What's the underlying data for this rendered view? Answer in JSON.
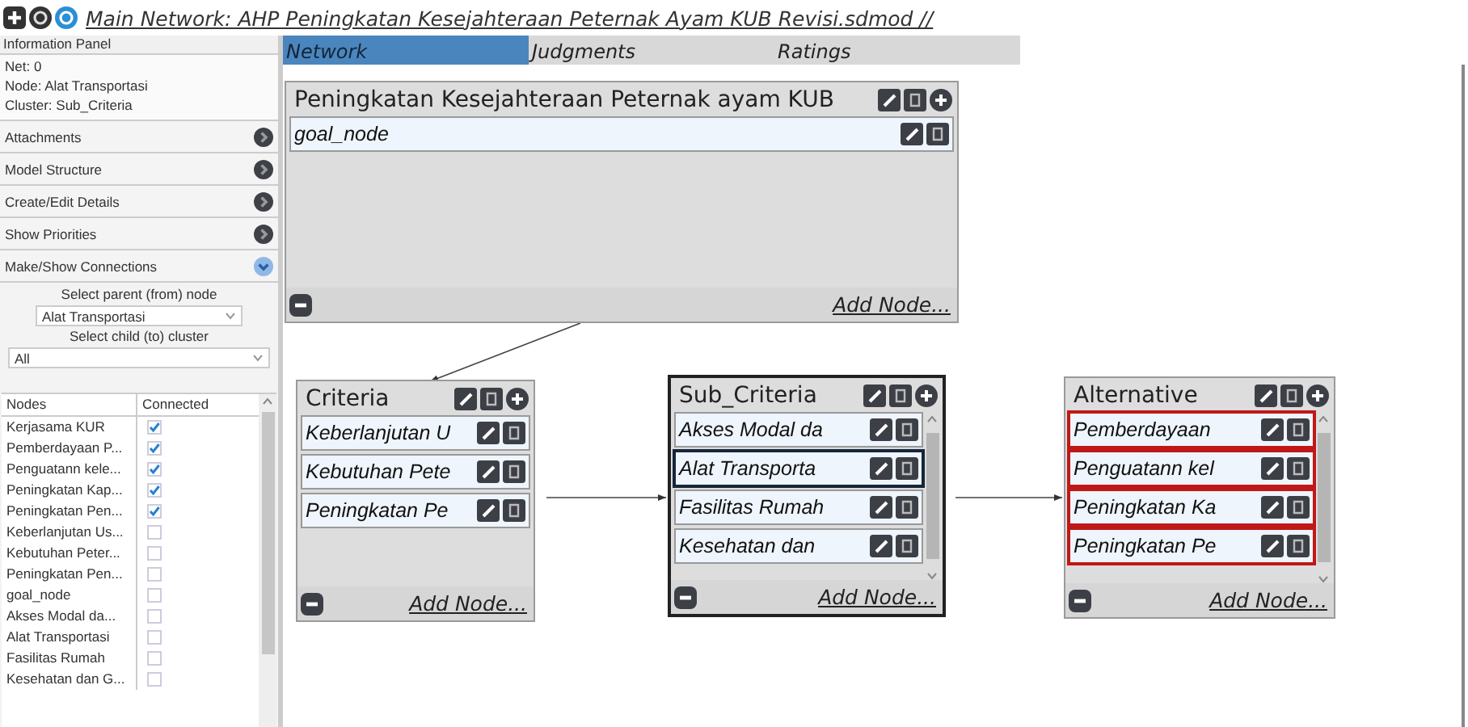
{
  "window": {
    "title": "Main Network: AHP Peningkatan Kesejahteraan Peternak Ayam KUB Revisi.sdmod //"
  },
  "info_panel": {
    "header": "Information Panel",
    "lines": [
      "Net: 0",
      "Node: Alat Transportasi",
      "Cluster: Sub_Criteria"
    ],
    "sections": [
      {
        "label": "Attachments",
        "expanded": false
      },
      {
        "label": "Model Structure",
        "expanded": false
      },
      {
        "label": "Create/Edit Details",
        "expanded": false
      },
      {
        "label": "Show Priorities",
        "expanded": false
      },
      {
        "label": "Make/Show Connections",
        "expanded": true
      }
    ],
    "parent_label": "Select parent (from) node",
    "parent_value": "Alat Transportasi",
    "child_label": "Select child (to) cluster",
    "child_value": "All",
    "table": {
      "columns": [
        "Nodes",
        "Connected"
      ],
      "rows": [
        {
          "node": "Kerjasama KUR",
          "connected": true
        },
        {
          "node": "Pemberdayaan P...",
          "connected": true
        },
        {
          "node": "Penguatann kele...",
          "connected": true
        },
        {
          "node": "Peningkatan Kap...",
          "connected": true
        },
        {
          "node": "Peningkatan Pen...",
          "connected": true
        },
        {
          "node": "Keberlanjutan Us...",
          "connected": false
        },
        {
          "node": "Kebutuhan Peter...",
          "connected": false
        },
        {
          "node": "Peningkatan Pen...",
          "connected": false
        },
        {
          "node": "goal_node",
          "connected": false
        },
        {
          "node": "Akses Modal da...",
          "connected": false
        },
        {
          "node": "Alat Transportasi",
          "connected": false
        },
        {
          "node": "Fasilitas Rumah",
          "connected": false
        },
        {
          "node": "Kesehatan dan G...",
          "connected": false
        }
      ]
    }
  },
  "tabs": [
    {
      "label": "Network",
      "selected": true
    },
    {
      "label": "Judgments",
      "selected": false
    },
    {
      "label": "Ratings",
      "selected": false
    }
  ],
  "clusters": [
    {
      "title": "Peningkatan Kesejahteraan Peternak ayam KUB",
      "selected": false,
      "add_label": "Add Node...",
      "nodes": [
        {
          "label": "goal_node",
          "selected": false,
          "connected": false
        }
      ]
    },
    {
      "title": "Criteria",
      "selected": false,
      "add_label": "Add Node...",
      "nodes": [
        {
          "label": "Keberlanjutan U",
          "selected": false,
          "connected": false
        },
        {
          "label": "Kebutuhan Pete",
          "selected": false,
          "connected": false
        },
        {
          "label": "Peningkatan Pe",
          "selected": false,
          "connected": false
        }
      ]
    },
    {
      "title": "Sub_Criteria",
      "selected": true,
      "add_label": "Add Node...",
      "nodes": [
        {
          "label": "Akses Modal da",
          "selected": false,
          "connected": false
        },
        {
          "label": "Alat Transporta",
          "selected": true,
          "connected": false
        },
        {
          "label": "Fasilitas Rumah",
          "selected": false,
          "connected": false
        },
        {
          "label": "Kesehatan dan",
          "selected": false,
          "connected": false
        }
      ]
    },
    {
      "title": "Alternative",
      "selected": false,
      "add_label": "Add Node...",
      "nodes": [
        {
          "label": "Pemberdayaan",
          "selected": false,
          "connected": true
        },
        {
          "label": "Penguatann kel",
          "selected": false,
          "connected": true
        },
        {
          "label": "Peningkatan Ka",
          "selected": false,
          "connected": true
        },
        {
          "label": "Peningkatan Pe",
          "selected": false,
          "connected": true
        }
      ]
    }
  ]
}
